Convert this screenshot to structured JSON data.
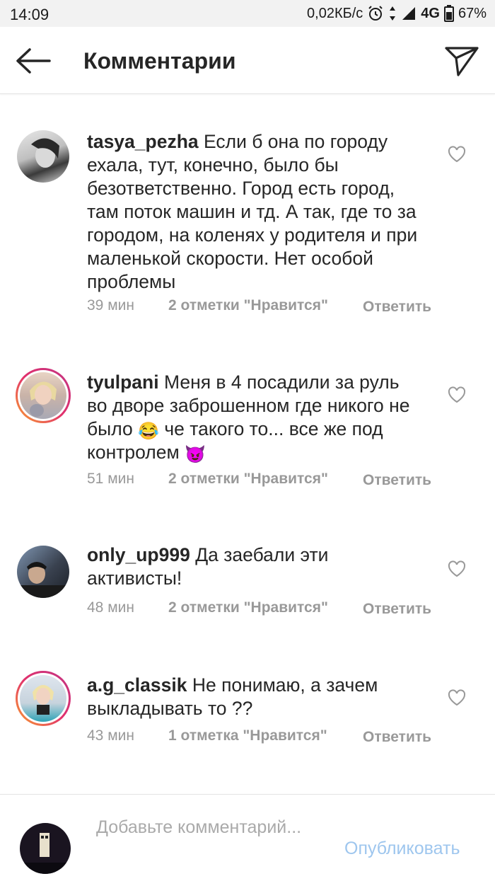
{
  "status_bar": {
    "time": "14:09",
    "network_speed": "0,02КБ/с",
    "network_type": "4G",
    "battery": "67%"
  },
  "header": {
    "title": "Комментарии",
    "back_icon": "arrow-left-icon",
    "share_icon": "paper-plane-icon"
  },
  "comments": [
    {
      "username": "tasya_pezha",
      "text": "Если б она по городу ехала, тут, конечно, было бы безответственно. Город есть город, там поток машин и тд. А так, где то за городом, на коленях у родителя и при маленькой скорости. Нет особой проблемы",
      "time": "39 мин",
      "likes": "2 отметки \"Нравится\"",
      "reply": "Ответить"
    },
    {
      "username": "tyulpani",
      "text_part1": "Меня в 4 посадили за руль во дворе заброшенном где никого не было",
      "emoji1": "😂",
      "text_part2": "че такого то... все же под контролем",
      "emoji2": "😈",
      "time": "51 мин",
      "likes": "2 отметки \"Нравится\"",
      "reply": "Ответить"
    },
    {
      "username": "only_up999",
      "text": "Да заебали эти активисты!",
      "time": "48 мин",
      "likes": "2 отметки \"Нравится\"",
      "reply": "Ответить"
    },
    {
      "username": "a.g_classik",
      "text": "Не понимаю, а зачем выкладывать то ??",
      "time": "43 мин",
      "likes": "1 отметка \"Нравится\"",
      "reply": "Ответить"
    }
  ],
  "footer": {
    "placeholder": "Добавьте комментарий...",
    "post_label": "Опубликовать"
  },
  "colors": {
    "accent_disabled": "#9ec6ee",
    "meta_gray": "#999999",
    "text": "#262626"
  }
}
